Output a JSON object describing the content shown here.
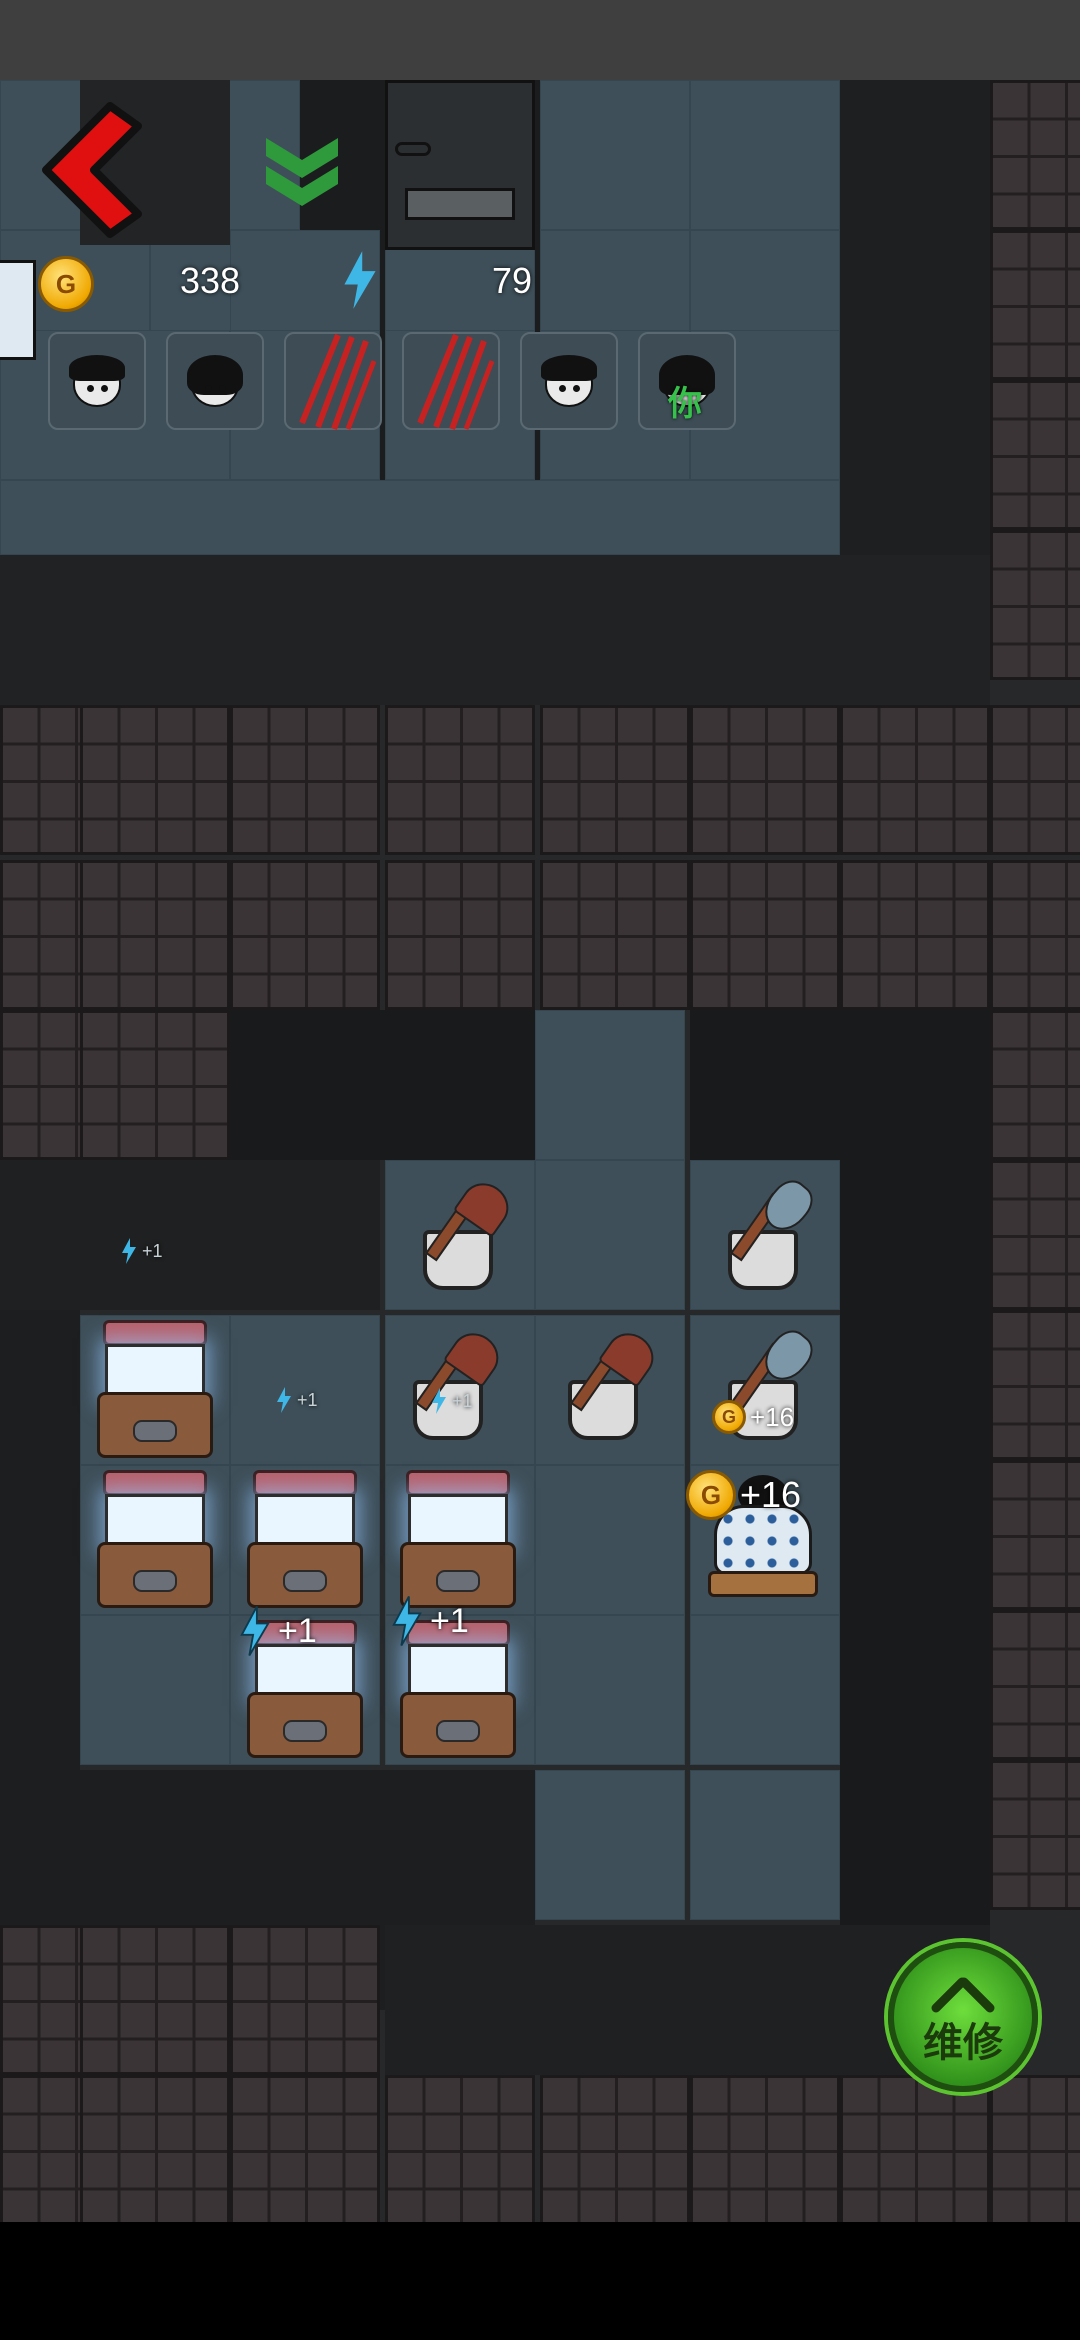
{
  "hud": {
    "gold": "338",
    "energy": "79",
    "coin_letter": "G"
  },
  "players": [
    {
      "icon": "boy-face-icon",
      "status": "alive"
    },
    {
      "icon": "girl-face-icon",
      "status": "alive"
    },
    {
      "icon": "clawed-face-icon",
      "status": "attacked"
    },
    {
      "icon": "clawed-face-icon",
      "status": "attacked"
    },
    {
      "icon": "boy-face-icon",
      "status": "alive"
    },
    {
      "icon": "self-face-icon",
      "status": "you",
      "label": "你"
    }
  ],
  "gains": {
    "energy_plus_small": "+1",
    "energy_plus_large": "+1",
    "gold_plus": "+16"
  },
  "repair_button": {
    "label": "维修"
  },
  "colors": {
    "back_arrow": "#e01010",
    "rank_chevrons": "#2e9a3c",
    "repair_button": "#4cc02a",
    "energy_bolt": "#3fb7e6",
    "floor": "#3e4f59",
    "wall": "#3a3436"
  }
}
